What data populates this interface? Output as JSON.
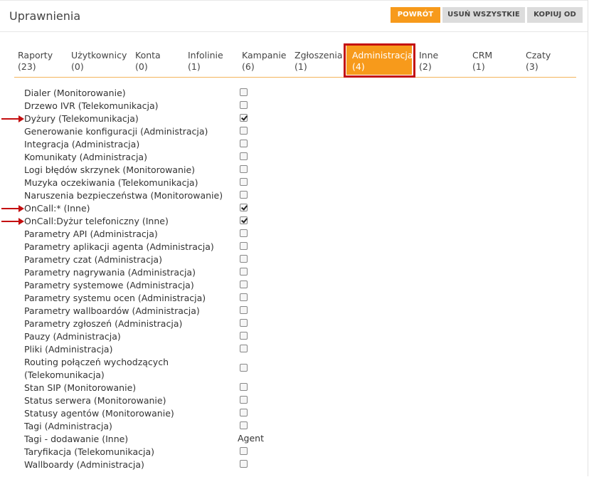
{
  "header": {
    "title": "Uprawnienia",
    "buttons": {
      "back": "POWRÓT",
      "remove_all": "USUŃ WSZYSTKIE",
      "copy_from": "KOPIUJ OD"
    }
  },
  "tabs": [
    {
      "label": "Raporty",
      "count": "(23)"
    },
    {
      "label": "Użytkownicy",
      "count": "(0)"
    },
    {
      "label": "Konta",
      "count": "(0)"
    },
    {
      "label": "Infolinie",
      "count": "(1)"
    },
    {
      "label": "Kampanie",
      "count": "(6)"
    },
    {
      "label": "Zgłoszenia",
      "count": "(1)"
    },
    {
      "label": "Administracja",
      "count": "(4)",
      "active": true
    },
    {
      "label": "Inne",
      "count": "(2)"
    },
    {
      "label": "CRM",
      "count": "(1)"
    },
    {
      "label": "Czaty",
      "count": "(3)"
    }
  ],
  "permissions": [
    {
      "label": "Dialer (Monitorowanie)",
      "checked": false
    },
    {
      "label": "Drzewo IVR (Telekomunikacja)",
      "checked": false
    },
    {
      "label": "Dyżury (Telekomunikacja)",
      "checked": true,
      "arrow": true
    },
    {
      "label": "Generowanie konfiguracji (Administracja)",
      "checked": false
    },
    {
      "label": "Integracja (Administracja)",
      "checked": false
    },
    {
      "label": "Komunikaty (Administracja)",
      "checked": false
    },
    {
      "label": "Logi błędów skrzynek (Monitorowanie)",
      "checked": false
    },
    {
      "label": "Muzyka oczekiwania (Telekomunikacja)",
      "checked": false
    },
    {
      "label": "Naruszenia bezpieczeństwa (Monitorowanie)",
      "checked": false
    },
    {
      "label": "OnCall:* (Inne)",
      "checked": true,
      "arrow": true
    },
    {
      "label": "OnCall:Dyżur telefoniczny (Inne)",
      "checked": true,
      "arrow": true
    },
    {
      "label": "Parametry API (Administracja)",
      "checked": false
    },
    {
      "label": "Parametry aplikacji agenta (Administracja)",
      "checked": false
    },
    {
      "label": "Parametry czat (Administracja)",
      "checked": false
    },
    {
      "label": "Parametry nagrywania (Administracja)",
      "checked": false
    },
    {
      "label": "Parametry systemowe (Administracja)",
      "checked": false
    },
    {
      "label": "Parametry systemu ocen (Administracja)",
      "checked": false
    },
    {
      "label": "Parametry wallboardów (Administracja)",
      "checked": false
    },
    {
      "label": "Parametry zgłoszeń (Administracja)",
      "checked": false
    },
    {
      "label": "Pauzy (Administracja)",
      "checked": false
    },
    {
      "label": "Pliki (Administracja)",
      "checked": false
    },
    {
      "label": "Routing połączeń wychodzących",
      "label2": "(Telekomunikacja)",
      "checked": false
    },
    {
      "label": "Stan SIP (Monitorowanie)",
      "checked": false
    },
    {
      "label": "Status serwera (Monitorowanie)",
      "checked": false
    },
    {
      "label": "Statusy agentów (Monitorowanie)",
      "checked": false
    },
    {
      "label": "Tagi (Administracja)",
      "checked": false
    },
    {
      "label": "Tagi - dodawanie (Inne)",
      "value": "Agent"
    },
    {
      "label": "Taryfikacja (Telekomunikacja)",
      "checked": false
    },
    {
      "label": "Wallboardy (Administracja)",
      "checked": false
    }
  ]
}
